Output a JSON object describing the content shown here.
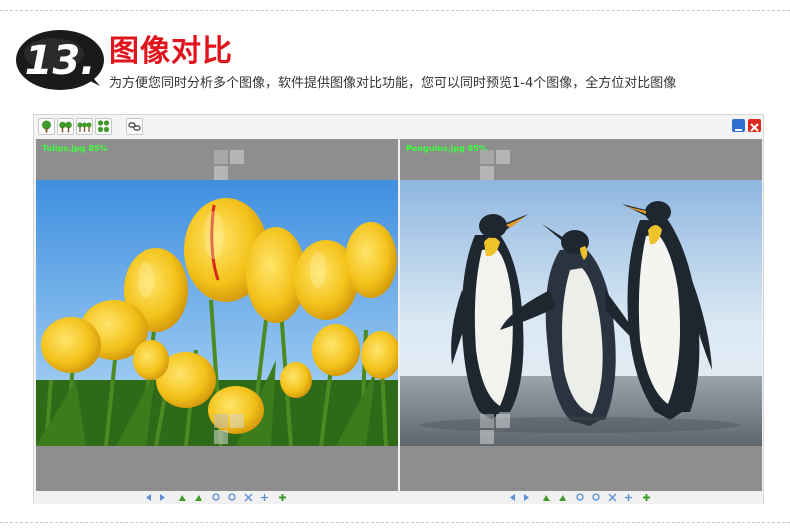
{
  "header": {
    "step_number": "13.",
    "title": "图像对比",
    "subtitle": "为方便您同时分析多个图像，软件提供图像对比功能，您可以同时预览1-4个图像，全方位对比图像"
  },
  "toolbar": {
    "layout_buttons": [
      "one-tree-icon",
      "two-trees-icon",
      "three-trees-icon",
      "four-trees-icon"
    ],
    "link_button": "chain-link-icon",
    "window_buttons": [
      "minimize-icon",
      "close-icon"
    ],
    "colors": {
      "minimize": "#2f6fd1",
      "close": "#d8281f"
    }
  },
  "panels": [
    {
      "label": "Tulips.jpg  85%",
      "image": "yellow tulips"
    },
    {
      "label": "Penguins.jpg  85%",
      "image": "penguins"
    }
  ],
  "statusbar": {
    "icons": [
      "prev-icon",
      "next-icon",
      "rotate-left-icon",
      "rotate-right-icon",
      "zoom-in-icon",
      "zoom-out-icon",
      "fit-icon",
      "actual-size-icon",
      "add-icon"
    ]
  },
  "colors": {
    "title_red": "#e0141c",
    "label_green": "#3cff3c",
    "panel_gray": "#8e8e8e"
  }
}
